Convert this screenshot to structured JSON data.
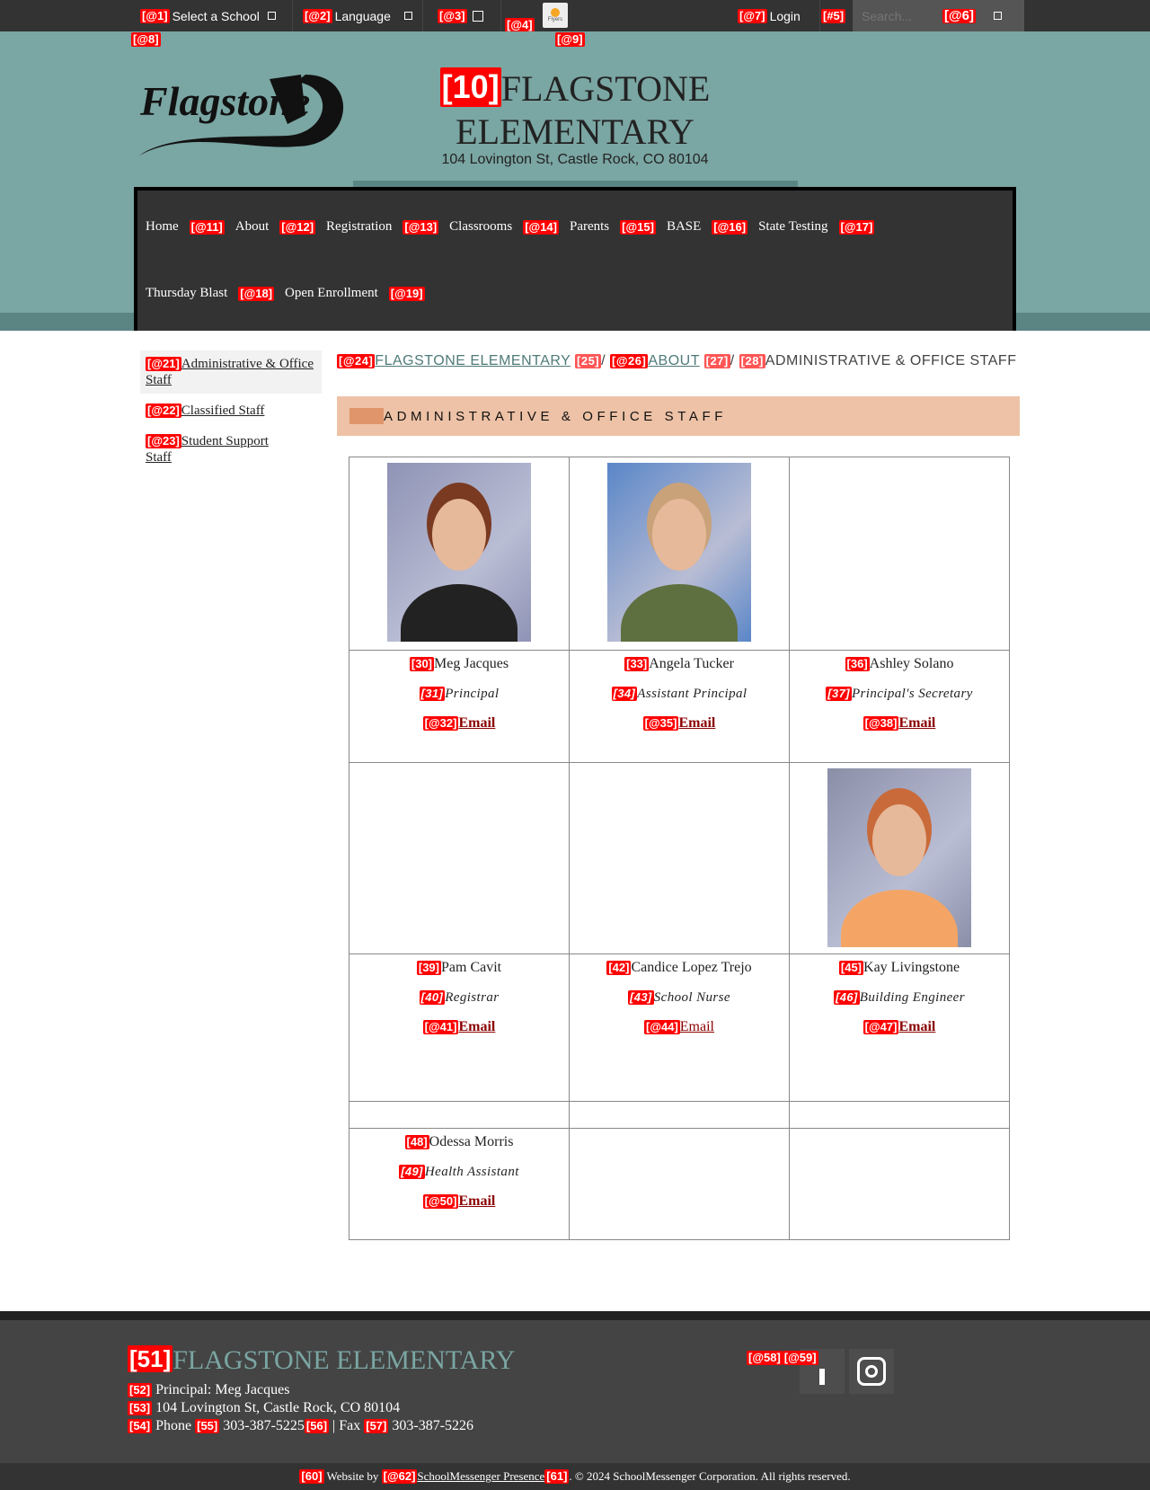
{
  "topbar": {
    "select_school": "Select a School",
    "select_badge": "[@1]",
    "language": "Language",
    "language_badge": "[@2]",
    "b3": "[@3]",
    "b4": "[@4]",
    "flyers": "Flyers",
    "b8": "[@8]",
    "b9": "[@9]",
    "login": "Login",
    "login_badge": "[@7]",
    "b5": "[#5]",
    "search_placeholder": "Search...",
    "search_badge": "[@6]"
  },
  "header": {
    "title_badge": "[10]",
    "title": "FLAGSTONE ELEMENTARY",
    "address": "104 Lovington St, Castle Rock, CO 80104",
    "logo_text": "Flagstone Elementary"
  },
  "nav": [
    {
      "label": "Home",
      "badge": "[@11]"
    },
    {
      "label": "About",
      "badge": "[@12]"
    },
    {
      "label": "Registration",
      "badge": "[@13]"
    },
    {
      "label": "Classrooms",
      "badge": "[@14]"
    },
    {
      "label": "Parents",
      "badge": "[@15]"
    },
    {
      "label": "BASE",
      "badge": "[@16]"
    },
    {
      "label": "State Testing",
      "badge": "[@17]"
    },
    {
      "label": "Thursday Blast",
      "badge": "[@18]"
    },
    {
      "label": "Open Enrollment",
      "badge": "[@19]"
    }
  ],
  "sidebar": [
    {
      "label": "Administrative & Office Staff",
      "badge": "[@21]"
    },
    {
      "label": "Classified Staff",
      "badge": "[@22]"
    },
    {
      "label": "Student Support Staff",
      "badge": "[@23]"
    }
  ],
  "breadcrumb": {
    "b24": "[@24]",
    "home": "FLAGSTONE ELEMENTARY",
    "b25": "[25]",
    "b26": "[@26]",
    "about": "ABOUT",
    "b27": "[27]",
    "b28": "[28]",
    "current": "ADMINISTRATIVE & OFFICE STAFF",
    "sep": "/"
  },
  "section_title": "ADMINISTRATIVE & OFFICE STAFF",
  "staff": [
    {
      "name": "Meg Jacques",
      "nb": "[30]",
      "role": "Principal",
      "rb": "[31]",
      "email": "Email",
      "eb": "[@32]"
    },
    {
      "name": "Angela Tucker",
      "nb": "[33]",
      "role": "Assistant Principal",
      "rb": "[34]",
      "email": "Email",
      "eb": "[@35]"
    },
    {
      "name": "Ashley Solano",
      "nb": "[36]",
      "role": "Principal's Secretary",
      "rb": "[37]",
      "email": "Email",
      "eb": "[@38]"
    },
    {
      "name": "Pam Cavit",
      "nb": "[39]",
      "role": "Registrar",
      "rb": "[40]",
      "email": "Email",
      "eb": "[@41]"
    },
    {
      "name": "Candice Lopez Trejo",
      "nb": "[42]",
      "role": "School Nurse",
      "rb": "[43]",
      "email": "Email",
      "eb": "[@44]"
    },
    {
      "name": "Kay Livingstone",
      "nb": "[45]",
      "role": "Building Engineer",
      "rb": "[46]",
      "email": "Email",
      "eb": "[@47]"
    },
    {
      "name": "Odessa Morris",
      "nb": "[48]",
      "role": "Health Assistant",
      "rb": "[49]",
      "email": "Email",
      "eb": "[@50]"
    }
  ],
  "footer": {
    "name_badge": "[51]",
    "name": "FLAGSTONE ELEMENTARY",
    "b52": "[52]",
    "principal": "Principal: Meg Jacques",
    "b53": "[53]",
    "address": "104 Lovington St, Castle Rock, CO 80104",
    "b54": "[54]",
    "phone_label": "Phone",
    "b55": "[55]",
    "phone": "303-387-5225",
    "b56": "[56]",
    "fax_label": "| Fax",
    "b57": "[57]",
    "fax": "303-387-5226",
    "b58": "[@58]",
    "b59": "[@59]",
    "b60": "[60]",
    "website_by": "Website by",
    "b62": "[@62]",
    "vendor": "SchoolMessenger Presence",
    "b61": "[61]",
    "copyright": ". © 2024 SchoolMessenger Corporation. All rights reserved."
  },
  "colors": {
    "teal": "#7aa6a3",
    "dark": "#333333",
    "section_bar": "#eec2a6",
    "email_link": "#8b0000"
  }
}
